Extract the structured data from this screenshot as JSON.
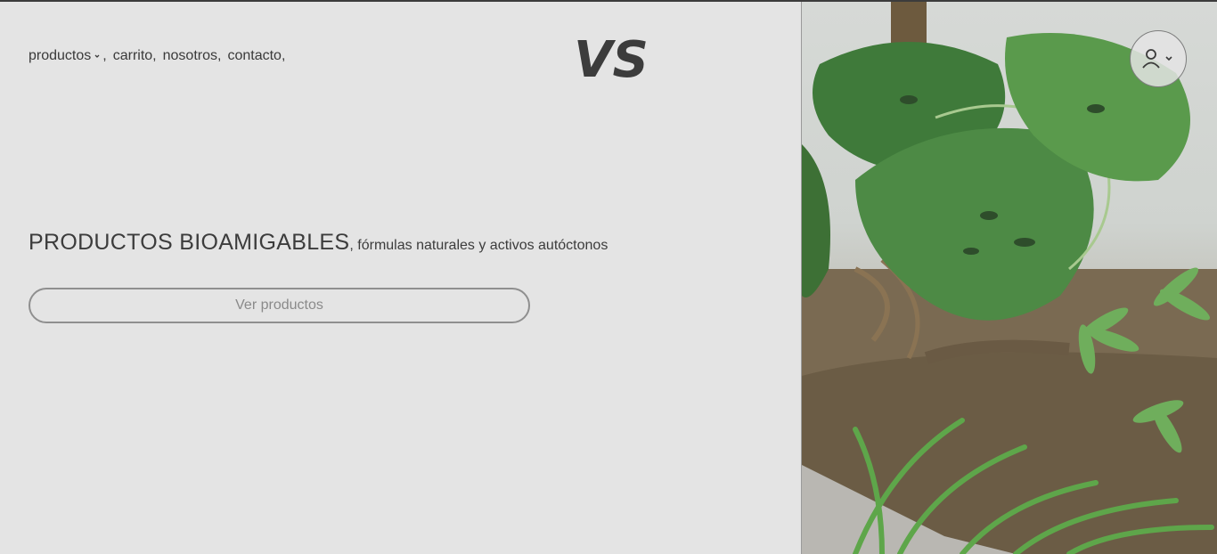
{
  "nav": {
    "items": [
      {
        "label": "productos",
        "has_dropdown": true,
        "sep": ","
      },
      {
        "label": "carrito",
        "sep": ","
      },
      {
        "label": "nosotros",
        "sep": ","
      },
      {
        "label": "contacto",
        "sep": ","
      }
    ]
  },
  "brand": {
    "logo_text": "VS"
  },
  "hero": {
    "title_main": "PRODUCTOS BIOAMIGABLES",
    "title_sub": ", fórmulas naturales y activos autóctonos",
    "cta_label": "Ver productos"
  },
  "user_menu": {
    "icon": "user-icon",
    "dropdown_icon": "chevron-down-icon"
  },
  "hero_image": {
    "subject": "monstera-and-tropical-plants-photo"
  },
  "colors": {
    "background": "#e4e4e4",
    "text": "#3a3a3a",
    "border": "#8f8f8f"
  }
}
